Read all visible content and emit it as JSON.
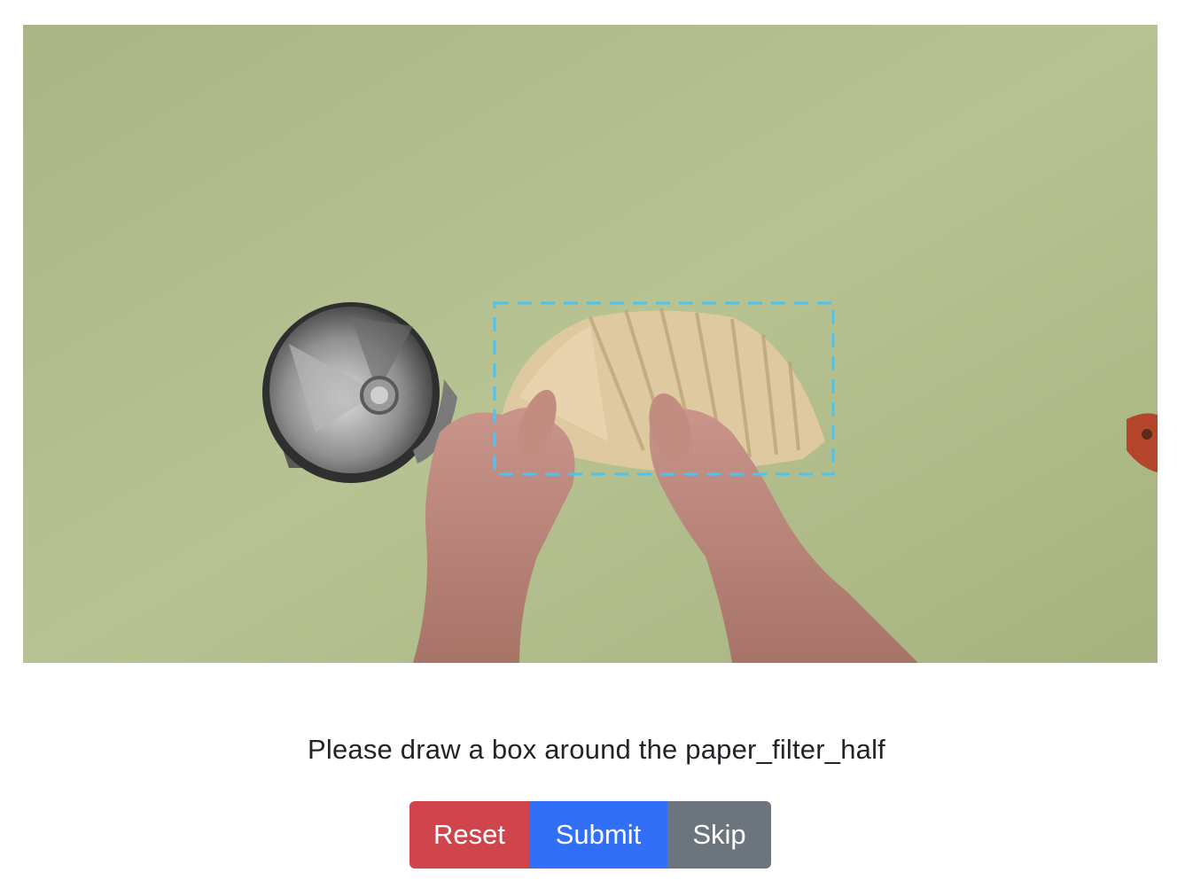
{
  "image": {
    "description_icon": "annotation-photo",
    "bbox_color": "#4cc3f0"
  },
  "instruction": {
    "text": "Please draw a box around the paper_filter_half"
  },
  "buttons": {
    "reset_label": "Reset",
    "submit_label": "Submit",
    "skip_label": "Skip"
  },
  "colors": {
    "reset": "#d0454c",
    "submit": "#316ff6",
    "skip": "#6c757d"
  }
}
